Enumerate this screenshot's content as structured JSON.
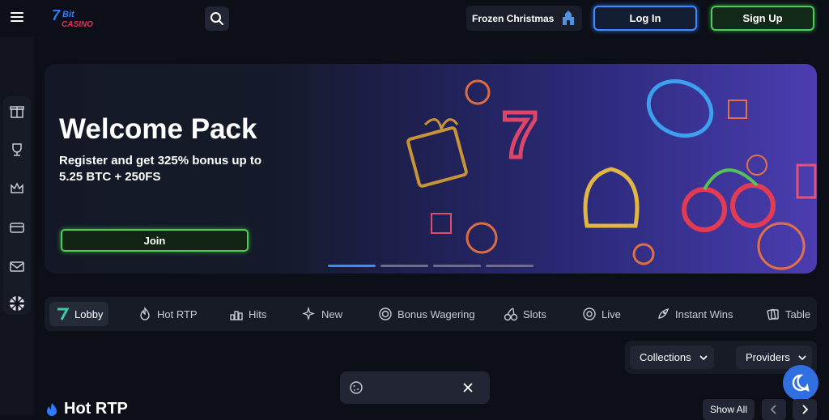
{
  "header": {
    "logo_text_top": "7Bit",
    "logo_text_bottom": "CASINO",
    "promo_label": "Frozen Christmas",
    "login_label": "Log In",
    "signup_label": "Sign Up"
  },
  "banner": {
    "title": "Welcome Pack",
    "subtitle": "Register and get 325% bonus up to 5.25 BTC + 250FS",
    "join_label": "Join",
    "slides_count": 4,
    "active_slide": 1
  },
  "categories": [
    {
      "label": "Lobby",
      "icon": "seven-icon",
      "active": true
    },
    {
      "label": "Hot RTP",
      "icon": "flame-icon"
    },
    {
      "label": "Hits",
      "icon": "chart-icon"
    },
    {
      "label": "New",
      "icon": "sparkle-icon"
    },
    {
      "label": "Bonus Wagering",
      "icon": "target-icon"
    },
    {
      "label": "Slots",
      "icon": "cherry-icon"
    },
    {
      "label": "Live",
      "icon": "chip-icon"
    },
    {
      "label": "Instant Wins",
      "icon": "rocket-icon"
    },
    {
      "label": "Table",
      "icon": "cards-icon"
    }
  ],
  "filters": {
    "collections_label": "Collections",
    "providers_label": "Providers"
  },
  "section": {
    "title": "Hot RTP",
    "show_all_label": "Show All"
  },
  "colors": {
    "accent_blue": "#3d8cff",
    "accent_green": "#4ecb5a",
    "background": "#0c0f17"
  }
}
